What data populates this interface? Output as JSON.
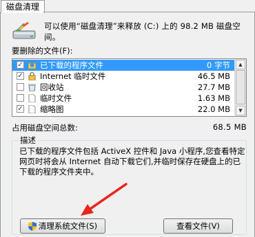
{
  "tab": {
    "label": "磁盘清理"
  },
  "intro": {
    "text": "可以使用“磁盘清理”来释放 (C:) 上的 98.2 MB 磁盘空间。"
  },
  "files_label": "要删除的文件(F):",
  "files": [
    {
      "name": "已下载的程序文件",
      "size": "0 字节",
      "checked": true,
      "selected": true,
      "icon": "folder-globe-icon"
    },
    {
      "name": "Internet 临时文件",
      "size": "46.5 MB",
      "checked": true,
      "selected": false,
      "icon": "lock-icon"
    },
    {
      "name": "回收站",
      "size": "27.7 MB",
      "checked": false,
      "selected": false,
      "icon": "recycle-bin-icon"
    },
    {
      "name": "临时文件",
      "size": "1.63 MB",
      "checked": false,
      "selected": false,
      "icon": "file-icon"
    },
    {
      "name": "缩略图",
      "size": "22.0 MB",
      "checked": true,
      "selected": false,
      "icon": "file-icon"
    }
  ],
  "total": {
    "label": "占用磁盘空间总数:",
    "value": "68.5 MB"
  },
  "description": {
    "title": "描述",
    "text": "已下载的程序文件包括 ActiveX 控件和 Java 小程序,您查看特定网页时将会从 Internet 自动下载它们,并临时保存在硬盘上的已下载的程序文件夹中。"
  },
  "buttons": {
    "clean": "清理系统文件(S)",
    "view": "查看文件(V)"
  },
  "colors": {
    "selection": "#3399ff",
    "arrow": "#e8261c",
    "panel": "#f0f0f0"
  }
}
